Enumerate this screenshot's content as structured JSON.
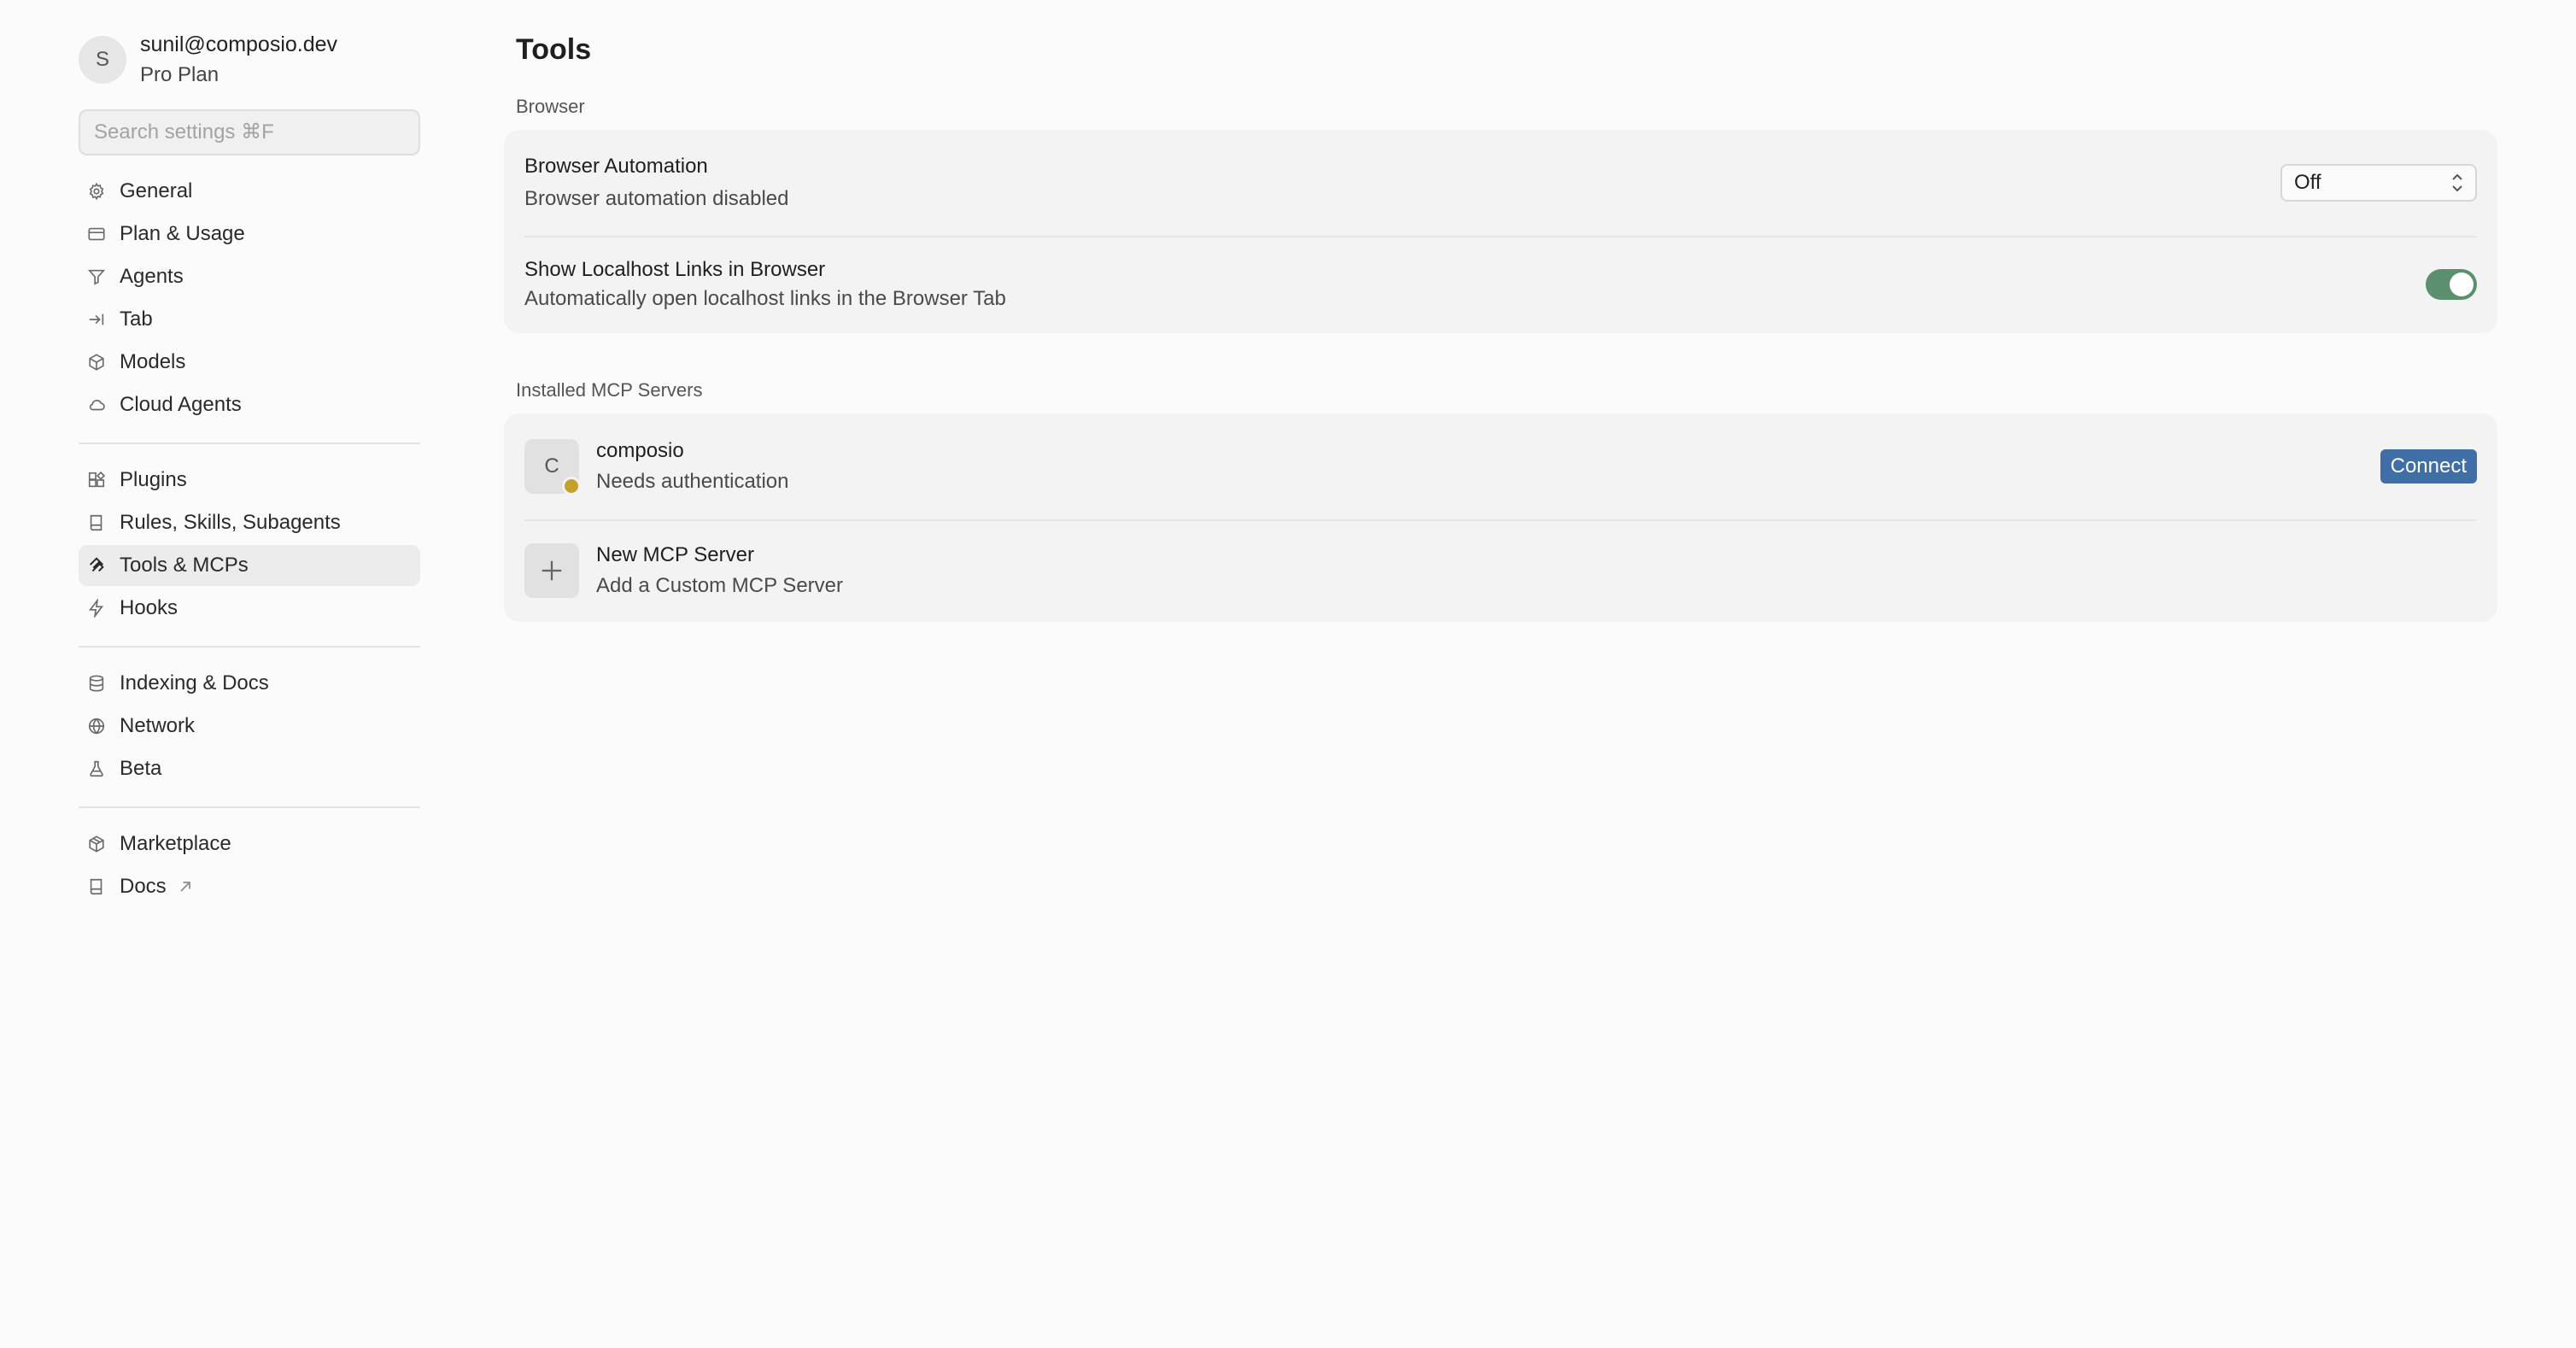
{
  "user": {
    "initial": "S",
    "email": "sunil@composio.dev",
    "plan": "Pro Plan"
  },
  "search": {
    "placeholder": "Search settings ⌘F"
  },
  "sidebar": {
    "groups": [
      {
        "items": [
          {
            "label": "General",
            "icon": "gear-icon"
          },
          {
            "label": "Plan & Usage",
            "icon": "card-icon"
          },
          {
            "label": "Agents",
            "icon": "funnel-icon"
          },
          {
            "label": "Tab",
            "icon": "tab-arrow-icon"
          },
          {
            "label": "Models",
            "icon": "cube-icon"
          },
          {
            "label": "Cloud Agents",
            "icon": "cloud-icon"
          }
        ]
      },
      {
        "items": [
          {
            "label": "Plugins",
            "icon": "puzzle-icon"
          },
          {
            "label": "Rules, Skills, Subagents",
            "icon": "book-icon"
          },
          {
            "label": "Tools & MCPs",
            "icon": "mcp-icon",
            "active": true
          },
          {
            "label": "Hooks",
            "icon": "lightning-icon"
          }
        ]
      },
      {
        "items": [
          {
            "label": "Indexing & Docs",
            "icon": "database-icon"
          },
          {
            "label": "Network",
            "icon": "globe-icon"
          },
          {
            "label": "Beta",
            "icon": "flask-icon"
          }
        ]
      },
      {
        "items": [
          {
            "label": "Marketplace",
            "icon": "package-icon"
          },
          {
            "label": "Docs",
            "icon": "docs-book-icon",
            "external": true
          }
        ]
      }
    ]
  },
  "main": {
    "title": "Tools",
    "browser": {
      "section_label": "Browser",
      "automation": {
        "title": "Browser Automation",
        "subtitle": "Browser automation disabled",
        "select_value": "Off"
      },
      "localhost": {
        "title": "Show Localhost Links in Browser",
        "subtitle": "Automatically open localhost links in the Browser Tab",
        "enabled": true
      }
    },
    "mcp": {
      "section_label": "Installed MCP Servers",
      "servers": [
        {
          "initial": "C",
          "name": "composio",
          "status": "Needs authentication",
          "action": "Connect"
        }
      ],
      "new_server": {
        "title": "New MCP Server",
        "subtitle": "Add a Custom MCP Server"
      }
    }
  },
  "colors": {
    "accent": "#3f6fa6",
    "toggle_on": "#5b8f6e",
    "status_warning": "#c4a12a"
  }
}
